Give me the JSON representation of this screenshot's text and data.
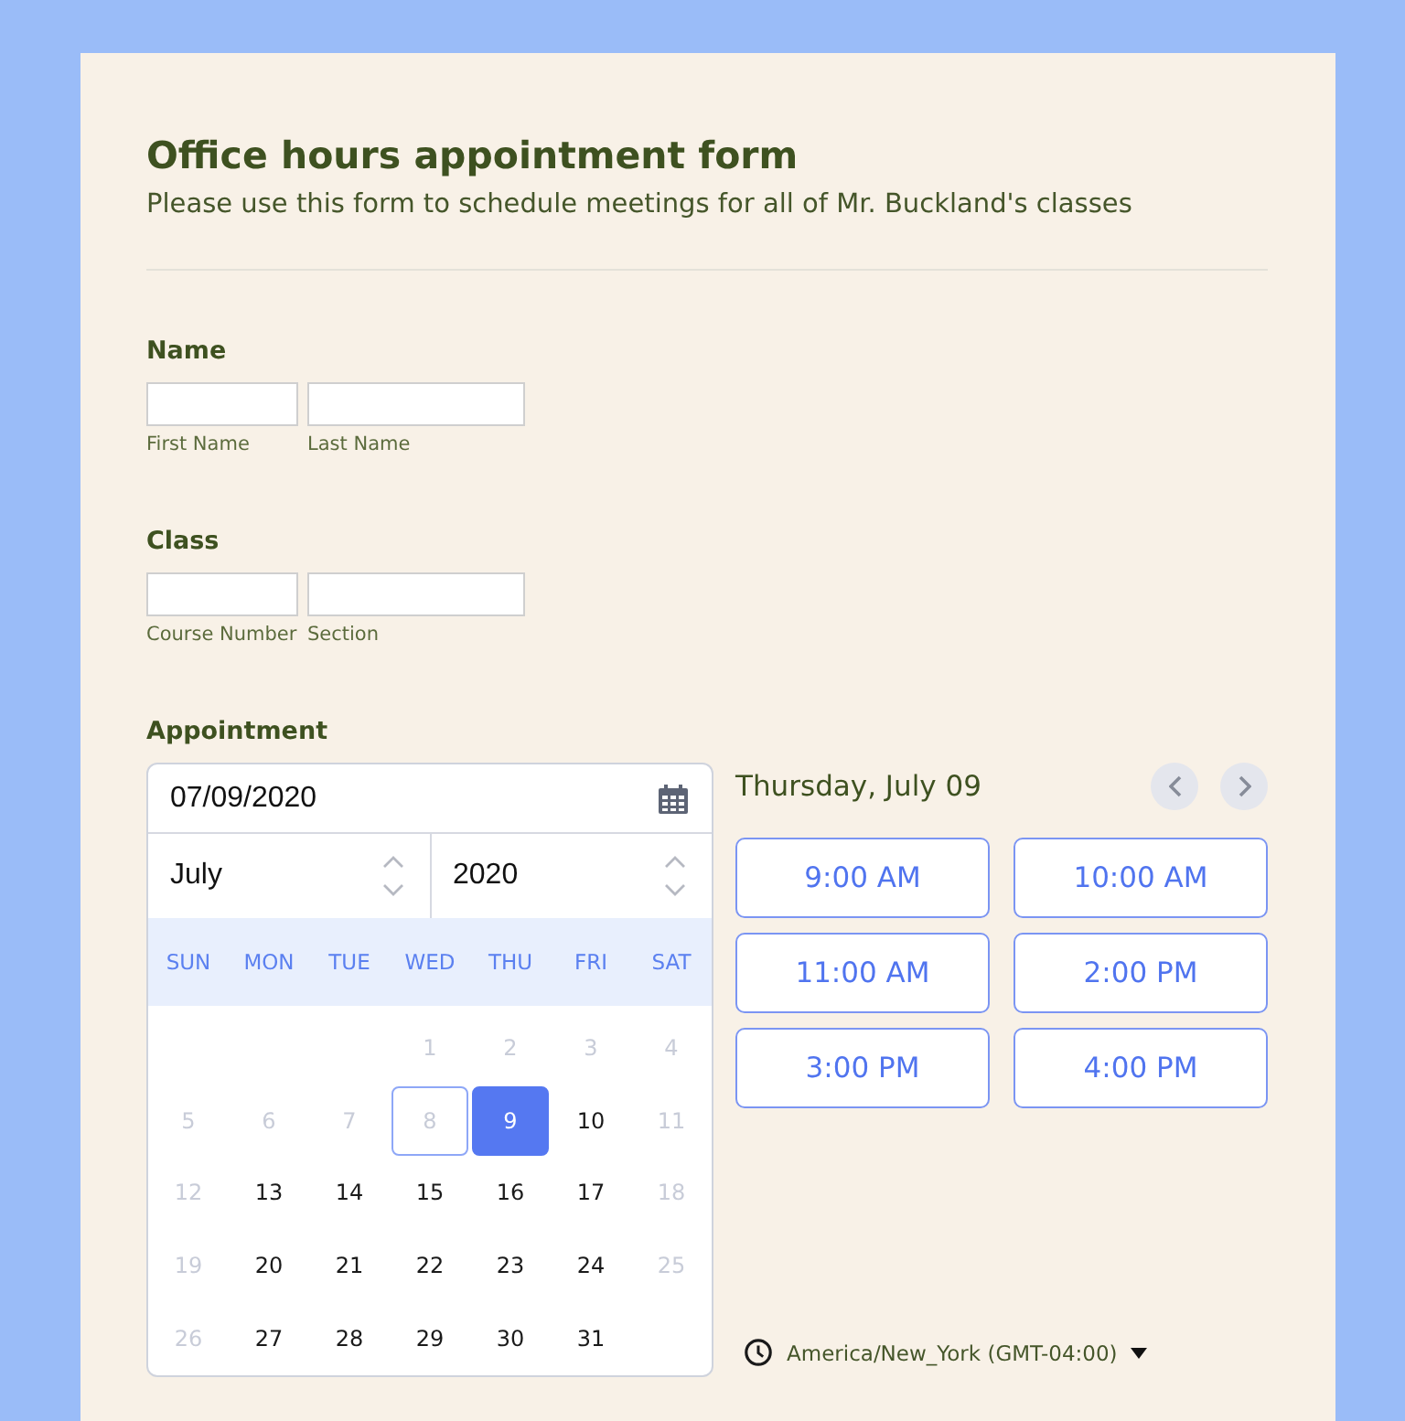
{
  "form": {
    "title": "Office hours appointment form",
    "subtitle": "Please use this form to schedule meetings for all of Mr. Buckland's classes"
  },
  "fields": [
    {
      "label": "Name",
      "inputs": [
        {
          "caption": "First Name"
        },
        {
          "caption": "Last Name"
        }
      ]
    },
    {
      "label": "Class",
      "inputs": [
        {
          "caption": "Course Number"
        },
        {
          "caption": "Section"
        }
      ]
    }
  ],
  "appointment": {
    "label": "Appointment",
    "date_value": "07/09/2020",
    "month": "July",
    "year": "2020",
    "weekdays": [
      "SUN",
      "MON",
      "TUE",
      "WED",
      "THU",
      "FRI",
      "SAT"
    ],
    "weeks": [
      {
        "days": [
          {
            "label": "1",
            "disabled": true,
            "selected": false,
            "today": false
          },
          {
            "label": "2",
            "disabled": true,
            "selected": false,
            "today": false
          },
          {
            "label": "3",
            "disabled": true,
            "selected": false,
            "today": false
          },
          {
            "label": "4",
            "disabled": true,
            "selected": false,
            "today": false
          }
        ]
      },
      {
        "days": [
          {
            "label": "5",
            "disabled": true,
            "selected": false,
            "today": false
          },
          {
            "label": "6",
            "disabled": true,
            "selected": false,
            "today": false
          },
          {
            "label": "7",
            "disabled": true,
            "selected": false,
            "today": false
          },
          {
            "label": "8",
            "disabled": true,
            "selected": false,
            "today": true
          },
          {
            "label": "9",
            "disabled": false,
            "selected": true,
            "today": false
          },
          {
            "label": "10",
            "disabled": false,
            "selected": false,
            "today": false
          },
          {
            "label": "11",
            "disabled": true,
            "selected": false,
            "today": false
          }
        ]
      },
      {
        "days": [
          {
            "label": "12",
            "disabled": true,
            "selected": false,
            "today": false
          },
          {
            "label": "13",
            "disabled": false,
            "selected": false,
            "today": false
          },
          {
            "label": "14",
            "disabled": false,
            "selected": false,
            "today": false
          },
          {
            "label": "15",
            "disabled": false,
            "selected": false,
            "today": false
          },
          {
            "label": "16",
            "disabled": false,
            "selected": false,
            "today": false
          },
          {
            "label": "17",
            "disabled": false,
            "selected": false,
            "today": false
          },
          {
            "label": "18",
            "disabled": true,
            "selected": false,
            "today": false
          }
        ]
      },
      {
        "days": [
          {
            "label": "19",
            "disabled": true,
            "selected": false,
            "today": false
          },
          {
            "label": "20",
            "disabled": false,
            "selected": false,
            "today": false
          },
          {
            "label": "21",
            "disabled": false,
            "selected": false,
            "today": false
          },
          {
            "label": "22",
            "disabled": false,
            "selected": false,
            "today": false
          },
          {
            "label": "23",
            "disabled": false,
            "selected": false,
            "today": false
          },
          {
            "label": "24",
            "disabled": false,
            "selected": false,
            "today": false
          },
          {
            "label": "25",
            "disabled": true,
            "selected": false,
            "today": false
          }
        ]
      },
      {
        "days": [
          {
            "label": "26",
            "disabled": true,
            "selected": false,
            "today": false
          },
          {
            "label": "27",
            "disabled": false,
            "selected": false,
            "today": false
          },
          {
            "label": "28",
            "disabled": false,
            "selected": false,
            "today": false
          },
          {
            "label": "29",
            "disabled": false,
            "selected": false,
            "today": false
          },
          {
            "label": "30",
            "disabled": false,
            "selected": false,
            "today": false
          },
          {
            "label": "31",
            "disabled": false,
            "selected": false,
            "today": false
          }
        ]
      }
    ],
    "selected_day": "Thursday, July 09",
    "time_slots": [
      {
        "label": "9:00 AM",
        "selected": false
      },
      {
        "label": "10:00 AM",
        "selected": false
      },
      {
        "label": "11:00 AM",
        "selected": false
      },
      {
        "label": "2:00 PM",
        "selected": false
      },
      {
        "label": "3:00 PM",
        "selected": false
      },
      {
        "label": "4:00 PM",
        "selected": false
      }
    ],
    "timezone": "America/New_York (GMT-04:00)"
  }
}
